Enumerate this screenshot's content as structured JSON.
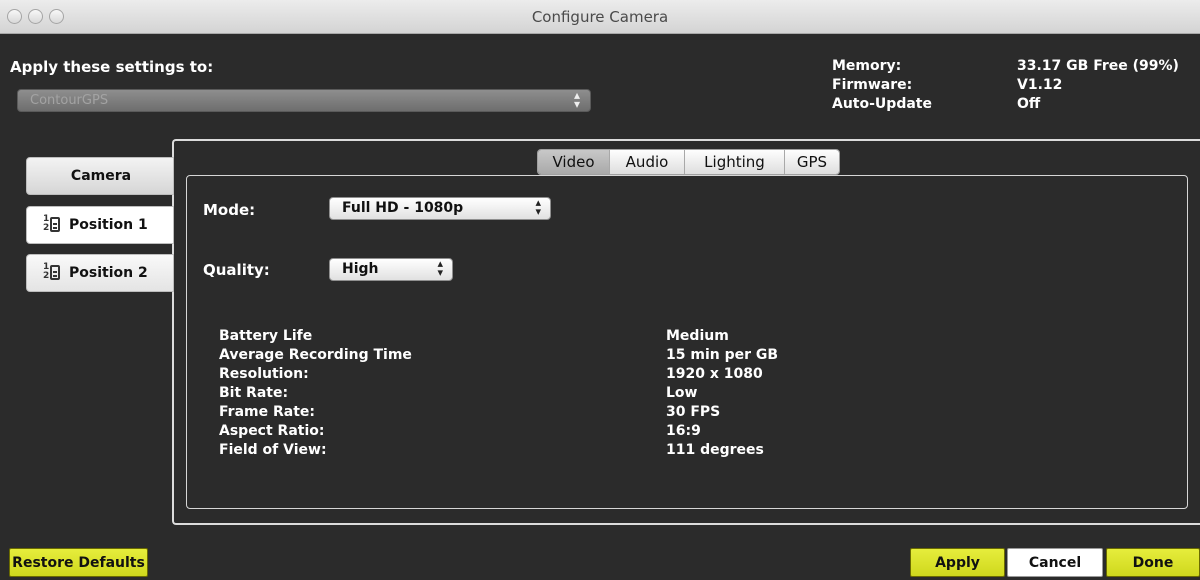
{
  "window": {
    "title": "Configure Camera"
  },
  "apply_to": {
    "label": "Apply these settings to:",
    "selected": "ContourGPS"
  },
  "device_info": [
    {
      "label": "Memory:",
      "value": "33.17 GB Free (99%)"
    },
    {
      "label": "Firmware:",
      "value": "V1.12"
    },
    {
      "label": "Auto-Update",
      "value": "Off"
    }
  ],
  "sidebar": {
    "items": [
      {
        "label": "Camera",
        "active": true
      },
      {
        "label": "Position 1",
        "icon": "position-switch-icon",
        "icon_top": "1",
        "icon_bottom": "2"
      },
      {
        "label": "Position 2",
        "icon": "position-switch-icon",
        "icon_top": "1",
        "icon_bottom": "2"
      }
    ]
  },
  "tabs": [
    {
      "label": "Video",
      "selected": true
    },
    {
      "label": "Audio"
    },
    {
      "label": "Lighting"
    },
    {
      "label": "GPS"
    }
  ],
  "settings": {
    "mode": {
      "label": "Mode:",
      "value": "Full HD - 1080p"
    },
    "quality": {
      "label": "Quality:",
      "value": "High"
    }
  },
  "specs": [
    {
      "label": "Battery Life",
      "value": "Medium"
    },
    {
      "label": "Average Recording Time",
      "value": "15 min per GB"
    },
    {
      "label": "Resolution:",
      "value": "1920 x 1080"
    },
    {
      "label": "Bit Rate:",
      "value": "Low"
    },
    {
      "label": "Frame Rate:",
      "value": "30 FPS"
    },
    {
      "label": "Aspect Ratio:",
      "value": "16:9"
    },
    {
      "label": "Field of View:",
      "value": "111 degrees"
    }
  ],
  "buttons": {
    "restore": "Restore Defaults",
    "apply": "Apply",
    "cancel": "Cancel",
    "done": "Done"
  },
  "colors": {
    "background": "#2b2b2b",
    "accent_button": "#dce42a",
    "panel_border": "#dcdcdc"
  },
  "icons": {
    "popup_arrows": "⬆⬇"
  }
}
